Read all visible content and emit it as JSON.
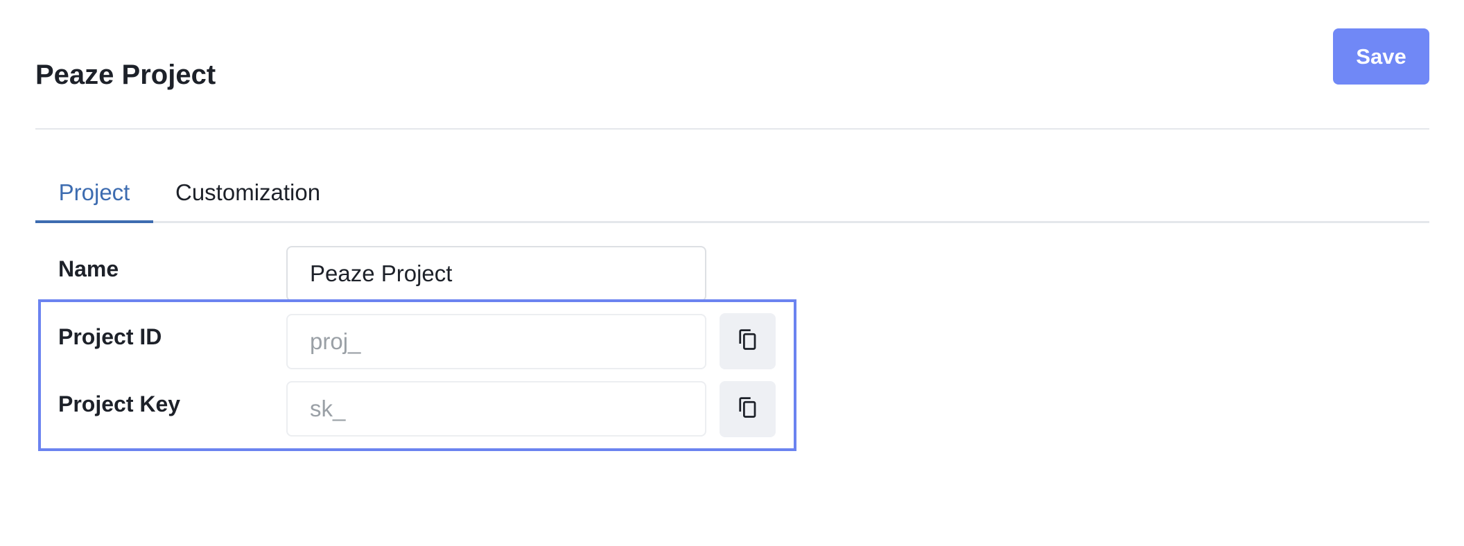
{
  "header": {
    "title": "Peaze Project",
    "save_label": "Save"
  },
  "tabs": [
    {
      "label": "Project",
      "active": true
    },
    {
      "label": "Customization",
      "active": false
    }
  ],
  "form": {
    "name": {
      "label": "Name",
      "value": "Peaze Project"
    },
    "project_id": {
      "label": "Project ID",
      "value": "proj_",
      "copy_icon": "copy-icon"
    },
    "project_key": {
      "label": "Project Key",
      "value": "sk_",
      "copy_icon": "copy-icon"
    }
  },
  "colors": {
    "accent": "#7088f6",
    "active_tab": "#3d6cb0",
    "highlight_border": "#6b83f0"
  }
}
